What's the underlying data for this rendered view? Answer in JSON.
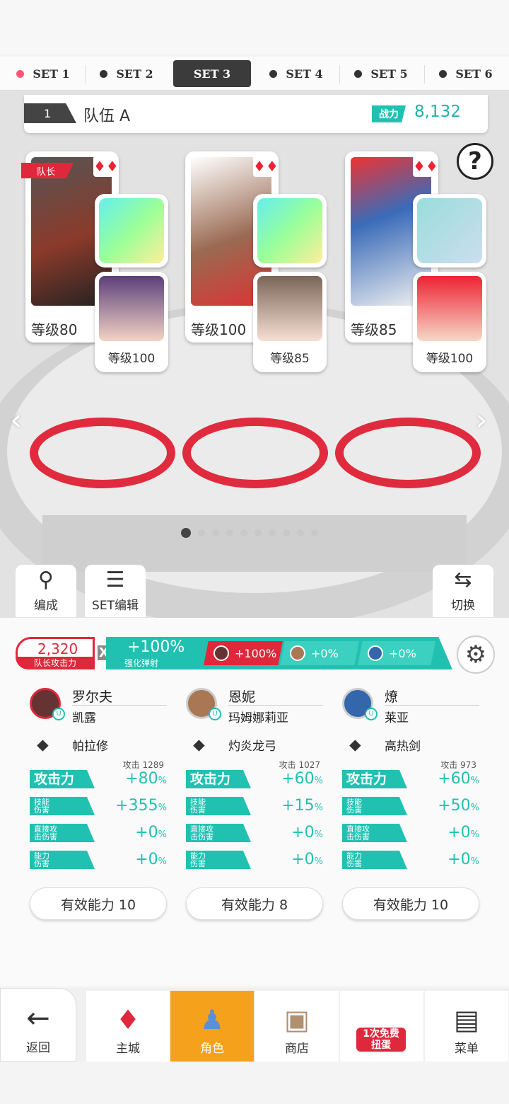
{
  "set_tabs": [
    {
      "label": "SET 1",
      "dot_color": "#ff5577"
    },
    {
      "label": "SET 2",
      "dot_color": "#333333"
    },
    {
      "label": "SET 3",
      "dot_color": "#333333"
    },
    {
      "label": "SET 4",
      "dot_color": "#333333"
    },
    {
      "label": "SET 5",
      "dot_color": "#333333"
    },
    {
      "label": "SET 6",
      "dot_color": "#333333"
    }
  ],
  "selected_set": "SET 3",
  "team": {
    "number": "1",
    "name": "队伍 A",
    "power_label": "战力",
    "power_value": "8,132"
  },
  "help_icon": "?",
  "leader_label": "队长",
  "characters": [
    {
      "level": "等级80",
      "sub_level": "等级100",
      "suit": "♦♦"
    },
    {
      "level": "等级100",
      "sub_level": "等级85",
      "suit": "♦♦"
    },
    {
      "level": "等级85",
      "sub_level": "等级100",
      "suit": "♦♦"
    }
  ],
  "pager": {
    "count": 10,
    "active": 0
  },
  "left_buttons": [
    {
      "label": "编成",
      "icon": "team-edit-icon"
    },
    {
      "label": "SET编辑",
      "icon": "list-icon"
    }
  ],
  "right_button": {
    "label": "切换",
    "icon": "swap-icon"
  },
  "leader_attack": {
    "value": "2,320",
    "label": "队长攻击力"
  },
  "multiplier": "X",
  "buff": {
    "main": "+100%",
    "label": "强化弹射",
    "chips": [
      "+100%",
      "+0%",
      "+0%"
    ]
  },
  "columns": [
    {
      "name": "罗尔夫",
      "sub": "凯露",
      "weapon": "帕拉修",
      "atk_ref": "攻击 1289",
      "stats": [
        {
          "label": "攻击力",
          "value": "+80",
          "unit": "%"
        },
        {
          "label": "技能\n伤害",
          "value": "+355",
          "unit": "%"
        },
        {
          "label": "直接攻\n击伤害",
          "value": "+0",
          "unit": "%"
        },
        {
          "label": "能力\n伤害",
          "value": "+0",
          "unit": "%"
        }
      ],
      "effective": "有效能力 10"
    },
    {
      "name": "恩妮",
      "sub": "玛姆娜莉亚",
      "weapon": "灼炎龙弓",
      "atk_ref": "攻击 1027",
      "stats": [
        {
          "label": "攻击力",
          "value": "+60",
          "unit": "%"
        },
        {
          "label": "技能\n伤害",
          "value": "+15",
          "unit": "%"
        },
        {
          "label": "直接攻\n击伤害",
          "value": "+0",
          "unit": "%"
        },
        {
          "label": "能力\n伤害",
          "value": "+0",
          "unit": "%"
        }
      ],
      "effective": "有效能力 8"
    },
    {
      "name": "燎",
      "sub": "莱亚",
      "weapon": "高热剑",
      "atk_ref": "攻击 973",
      "stats": [
        {
          "label": "攻击力",
          "value": "+60",
          "unit": "%"
        },
        {
          "label": "技能\n伤害",
          "value": "+50",
          "unit": "%"
        },
        {
          "label": "直接攻\n击伤害",
          "value": "+0",
          "unit": "%"
        },
        {
          "label": "能力\n伤害",
          "value": "+0",
          "unit": "%"
        }
      ],
      "effective": "有效能力 10"
    }
  ],
  "nav": {
    "back": "返回",
    "items": [
      "主城",
      "角色",
      "商店",
      "1次免费\n扭蛋",
      "菜单"
    ],
    "selected": "角色",
    "free_badge": "1次免费\n扭蛋"
  },
  "colors": {
    "accent": "#21c1b1",
    "red": "#e0283c",
    "selected_nav": "#f5a11b"
  }
}
